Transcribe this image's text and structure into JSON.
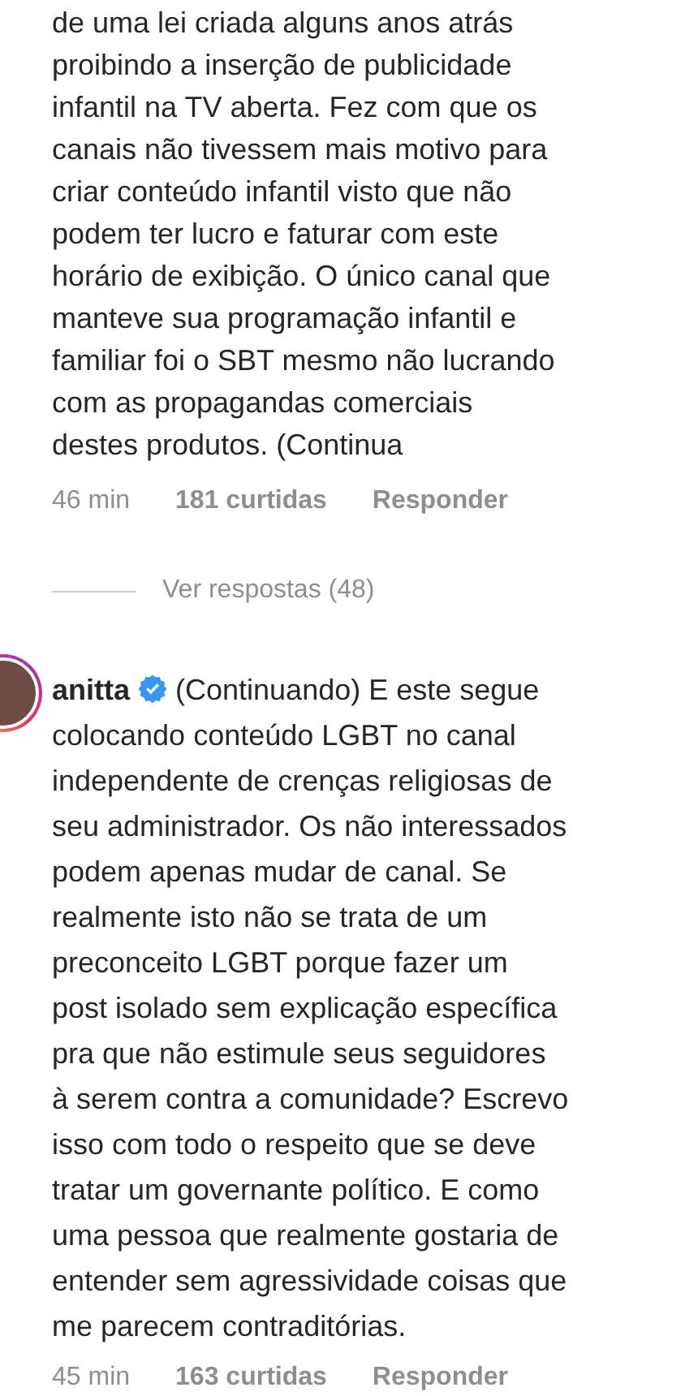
{
  "comments": [
    {
      "text": "de uma lei criada alguns anos atrás\nproibindo a inserção de publicidade\ninfantil na TV aberta. Fez com que os\ncanais não tivessem mais motivo para\ncriar conteúdo infantil visto que não\npodem ter lucro e faturar com este\nhorário de exibição. O único canal que\nmanteve sua programação infantil e\nfamiliar foi o SBT mesmo não lucrando\ncom as propagandas comerciais\ndestes produtos. (Continua",
      "time": "46 min",
      "likes": "181 curtidas",
      "reply": "Responder",
      "replies_link": "Ver respostas (48)"
    },
    {
      "username": "anitta",
      "verified": true,
      "text": "(Continuando) E este segue\ncolocando conteúdo LGBT no canal\nindependente de crenças religiosas de\nseu administrador. Os não interessados\npodem apenas mudar de canal. Se\nrealmente isto não se trata de um\npreconceito LGBT porque fazer um\npost isolado sem explicação específica\npra que não estimule seus seguidores\nà serem contra a comunidade? Escrevo\nisso com todo o respeito que se deve\ntratar um governante político. E como\numa pessoa que realmente gostaria de\nentender sem agressividade coisas que\nme parecem contraditórias.",
      "time": "45 min",
      "likes": "163 curtidas",
      "reply": "Responder"
    }
  ]
}
